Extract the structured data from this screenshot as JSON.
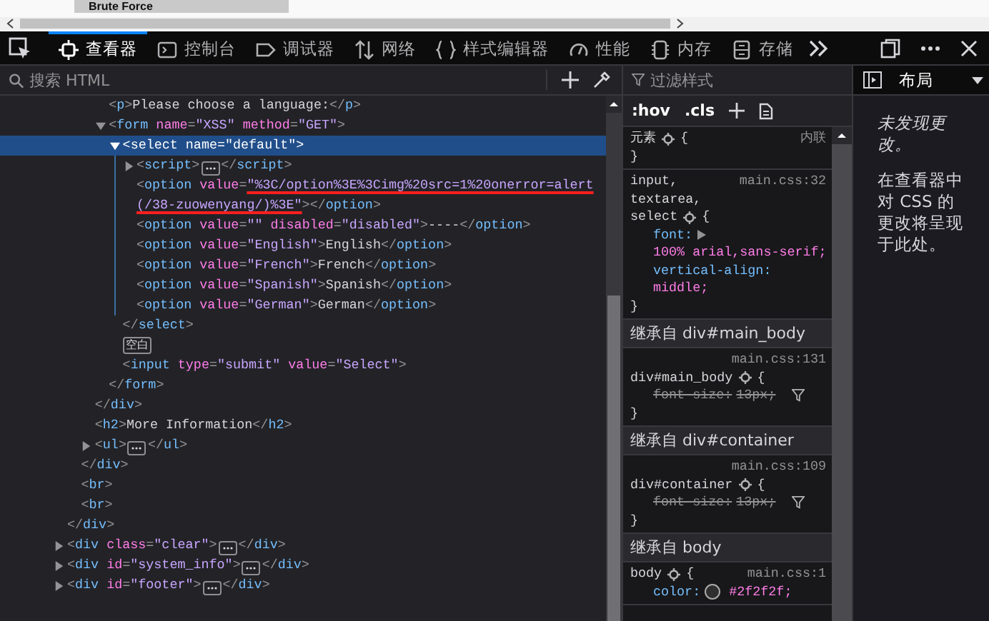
{
  "page": {
    "button_label": "Brute Force"
  },
  "toolbar": {
    "tabs": [
      {
        "kind": "inspector",
        "label": "查看器",
        "selected": true
      },
      {
        "kind": "console",
        "label": "控制台",
        "selected": false
      },
      {
        "kind": "debugger",
        "label": "调试器",
        "selected": false
      },
      {
        "kind": "network",
        "label": "网络",
        "selected": false
      },
      {
        "kind": "style-editor",
        "label": "样式编辑器",
        "selected": false
      },
      {
        "kind": "performance",
        "label": "性能",
        "selected": false
      },
      {
        "kind": "memory",
        "label": "内存",
        "selected": false
      },
      {
        "kind": "storage",
        "label": "存储",
        "selected": false
      }
    ]
  },
  "markup": {
    "search_placeholder": "搜索 HTML",
    "nodes": [
      {
        "close": [
          {
            "kind": "punct",
            "text": "</"
          },
          {
            "kind": "tag",
            "text": "div"
          },
          {
            "kind": "punct",
            "text": ">"
          }
        ],
        "children": [
          {
            "close": [
              {
                "kind": "punct",
                "text": "</"
              },
              {
                "kind": "tag",
                "text": "div"
              },
              {
                "kind": "punct",
                "text": ">"
              }
            ],
            "children": [
              {
                "close": [
                  {
                    "kind": "punct",
                    "text": "</"
                  },
                  {
                    "kind": "tag",
                    "text": "div"
                  },
                  {
                    "kind": "punct",
                    "text": ">"
                  }
                ],
                "children": [
                  {
                    "selected": false,
                    "tokens": [
                      {
                        "kind": "punct",
                        "text": "<"
                      },
                      {
                        "kind": "tag",
                        "text": "p"
                      },
                      {
                        "kind": "punct",
                        "text": ">"
                      },
                      {
                        "kind": "text",
                        "text": "Please choose a language:"
                      },
                      {
                        "kind": "punct",
                        "text": "</"
                      },
                      {
                        "kind": "tag",
                        "text": "p"
                      },
                      {
                        "kind": "punct",
                        "text": ">"
                      }
                    ]
                  },
                  {
                    "selected": false,
                    "expanded": true,
                    "tokens": [
                      {
                        "kind": "punct",
                        "text": "<"
                      },
                      {
                        "kind": "tag",
                        "text": "form"
                      },
                      {
                        "kind": "attr",
                        "text": " name"
                      },
                      {
                        "kind": "punct",
                        "text": "="
                      },
                      {
                        "kind": "value",
                        "text": "\"XSS\""
                      },
                      {
                        "kind": "attr",
                        "text": " method"
                      },
                      {
                        "kind": "punct",
                        "text": "="
                      },
                      {
                        "kind": "value",
                        "text": "\"GET\""
                      },
                      {
                        "kind": "punct",
                        "text": ">"
                      }
                    ],
                    "close": [
                      {
                        "kind": "punct",
                        "text": "</"
                      },
                      {
                        "kind": "tag",
                        "text": "form"
                      },
                      {
                        "kind": "punct",
                        "text": ">"
                      }
                    ],
                    "children": [
                      {
                        "selected": true,
                        "expanded": true,
                        "tokens": [
                          {
                            "kind": "punct",
                            "text": "<"
                          },
                          {
                            "kind": "tag",
                            "text": "select"
                          },
                          {
                            "kind": "attr",
                            "text": " name"
                          },
                          {
                            "kind": "punct",
                            "text": "="
                          },
                          {
                            "kind": "value",
                            "text": "\"default\""
                          },
                          {
                            "kind": "punct",
                            "text": ">"
                          }
                        ],
                        "close": [
                          {
                            "kind": "punct",
                            "text": "</"
                          },
                          {
                            "kind": "tag",
                            "text": "select"
                          },
                          {
                            "kind": "punct",
                            "text": ">"
                          }
                        ],
                        "children": [
                          {
                            "selected": false,
                            "expanded": false,
                            "tokens": [
                              {
                                "kind": "punct",
                                "text": "<"
                              },
                              {
                                "kind": "tag",
                                "text": "script"
                              },
                              {
                                "kind": "punct",
                                "text": ">"
                              },
                              {
                                "kind": "ellipsis"
                              },
                              {
                                "kind": "punct",
                                "text": "</"
                              },
                              {
                                "kind": "tag",
                                "text": "script"
                              },
                              {
                                "kind": "punct",
                                "text": ">"
                              }
                            ]
                          },
                          {
                            "selected": false,
                            "tokens": [
                              {
                                "kind": "punct",
                                "text": "<"
                              },
                              {
                                "kind": "tag",
                                "text": "option"
                              },
                              {
                                "kind": "attr",
                                "text": " value"
                              },
                              {
                                "kind": "punct",
                                "text": "="
                              },
                              {
                                "kind": "value",
                                "text": "\"%3C/option%3E%3Cimg%20src=1%20onerror=alert(/38-zuowenyang/)%3E\"",
                                "annotated": true
                              },
                              {
                                "kind": "punct",
                                "text": ">"
                              },
                              {
                                "kind": "punct",
                                "text": "</"
                              },
                              {
                                "kind": "tag",
                                "text": "option"
                              },
                              {
                                "kind": "punct",
                                "text": ">"
                              }
                            ]
                          },
                          {
                            "selected": false,
                            "tokens": [
                              {
                                "kind": "punct",
                                "text": "<"
                              },
                              {
                                "kind": "tag",
                                "text": "option"
                              },
                              {
                                "kind": "attr",
                                "text": " value"
                              },
                              {
                                "kind": "punct",
                                "text": "="
                              },
                              {
                                "kind": "value",
                                "text": "\"\""
                              },
                              {
                                "kind": "attr",
                                "text": " disabled"
                              },
                              {
                                "kind": "punct",
                                "text": "="
                              },
                              {
                                "kind": "value",
                                "text": "\"disabled\""
                              },
                              {
                                "kind": "punct",
                                "text": ">"
                              },
                              {
                                "kind": "text",
                                "text": "----"
                              },
                              {
                                "kind": "punct",
                                "text": "</"
                              },
                              {
                                "kind": "tag",
                                "text": "option"
                              },
                              {
                                "kind": "punct",
                                "text": ">"
                              }
                            ]
                          },
                          {
                            "selected": false,
                            "tokens": [
                              {
                                "kind": "punct",
                                "text": "<"
                              },
                              {
                                "kind": "tag",
                                "text": "option"
                              },
                              {
                                "kind": "attr",
                                "text": " value"
                              },
                              {
                                "kind": "punct",
                                "text": "="
                              },
                              {
                                "kind": "value",
                                "text": "\"English\""
                              },
                              {
                                "kind": "punct",
                                "text": ">"
                              },
                              {
                                "kind": "text",
                                "text": "English"
                              },
                              {
                                "kind": "punct",
                                "text": "</"
                              },
                              {
                                "kind": "tag",
                                "text": "option"
                              },
                              {
                                "kind": "punct",
                                "text": ">"
                              }
                            ]
                          },
                          {
                            "selected": false,
                            "tokens": [
                              {
                                "kind": "punct",
                                "text": "<"
                              },
                              {
                                "kind": "tag",
                                "text": "option"
                              },
                              {
                                "kind": "attr",
                                "text": " value"
                              },
                              {
                                "kind": "punct",
                                "text": "="
                              },
                              {
                                "kind": "value",
                                "text": "\"French\""
                              },
                              {
                                "kind": "punct",
                                "text": ">"
                              },
                              {
                                "kind": "text",
                                "text": "French"
                              },
                              {
                                "kind": "punct",
                                "text": "</"
                              },
                              {
                                "kind": "tag",
                                "text": "option"
                              },
                              {
                                "kind": "punct",
                                "text": ">"
                              }
                            ]
                          },
                          {
                            "selected": false,
                            "tokens": [
                              {
                                "kind": "punct",
                                "text": "<"
                              },
                              {
                                "kind": "tag",
                                "text": "option"
                              },
                              {
                                "kind": "attr",
                                "text": " value"
                              },
                              {
                                "kind": "punct",
                                "text": "="
                              },
                              {
                                "kind": "value",
                                "text": "\"Spanish\""
                              },
                              {
                                "kind": "punct",
                                "text": ">"
                              },
                              {
                                "kind": "text",
                                "text": "Spanish"
                              },
                              {
                                "kind": "punct",
                                "text": "</"
                              },
                              {
                                "kind": "tag",
                                "text": "option"
                              },
                              {
                                "kind": "punct",
                                "text": ">"
                              }
                            ]
                          },
                          {
                            "selected": false,
                            "tokens": [
                              {
                                "kind": "punct",
                                "text": "<"
                              },
                              {
                                "kind": "tag",
                                "text": "option"
                              },
                              {
                                "kind": "attr",
                                "text": " value"
                              },
                              {
                                "kind": "punct",
                                "text": "="
                              },
                              {
                                "kind": "value",
                                "text": "\"German\""
                              },
                              {
                                "kind": "punct",
                                "text": ">"
                              },
                              {
                                "kind": "text",
                                "text": "German"
                              },
                              {
                                "kind": "punct",
                                "text": "</"
                              },
                              {
                                "kind": "tag",
                                "text": "option"
                              },
                              {
                                "kind": "punct",
                                "text": ">"
                              }
                            ]
                          }
                        ]
                      },
                      {
                        "kind": "whitespace",
                        "label": "空白",
                        "selected": false
                      },
                      {
                        "selected": false,
                        "tokens": [
                          {
                            "kind": "punct",
                            "text": "<"
                          },
                          {
                            "kind": "tag",
                            "text": "input"
                          },
                          {
                            "kind": "attr",
                            "text": " type"
                          },
                          {
                            "kind": "punct",
                            "text": "="
                          },
                          {
                            "kind": "value",
                            "text": "\"submit\""
                          },
                          {
                            "kind": "attr",
                            "text": " value"
                          },
                          {
                            "kind": "punct",
                            "text": "="
                          },
                          {
                            "kind": "value",
                            "text": "\"Select\""
                          },
                          {
                            "kind": "punct",
                            "text": ">"
                          }
                        ]
                      }
                    ]
                  }
                ]
              },
              {
                "selected": false,
                "tokens": [
                  {
                    "kind": "punct",
                    "text": "<"
                  },
                  {
                    "kind": "tag",
                    "text": "h2"
                  },
                  {
                    "kind": "punct",
                    "text": ">"
                  },
                  {
                    "kind": "text",
                    "text": "More Information"
                  },
                  {
                    "kind": "punct",
                    "text": "</"
                  },
                  {
                    "kind": "tag",
                    "text": "h2"
                  },
                  {
                    "kind": "punct",
                    "text": ">"
                  }
                ]
              },
              {
                "selected": false,
                "expanded": false,
                "tokens": [
                  {
                    "kind": "punct",
                    "text": "<"
                  },
                  {
                    "kind": "tag",
                    "text": "ul"
                  },
                  {
                    "kind": "punct",
                    "text": ">"
                  },
                  {
                    "kind": "ellipsis"
                  },
                  {
                    "kind": "punct",
                    "text": "</"
                  },
                  {
                    "kind": "tag",
                    "text": "ul"
                  },
                  {
                    "kind": "punct",
                    "text": ">"
                  }
                ]
              }
            ]
          },
          {
            "selected": false,
            "tokens": [
              {
                "kind": "punct",
                "text": "<"
              },
              {
                "kind": "tag",
                "text": "br"
              },
              {
                "kind": "punct",
                "text": ">"
              }
            ]
          },
          {
            "selected": false,
            "tokens": [
              {
                "kind": "punct",
                "text": "<"
              },
              {
                "kind": "tag",
                "text": "br"
              },
              {
                "kind": "punct",
                "text": ">"
              }
            ]
          }
        ]
      },
      {
        "selected": false,
        "expanded": false,
        "tokens": [
          {
            "kind": "punct",
            "text": "<"
          },
          {
            "kind": "tag",
            "text": "div"
          },
          {
            "kind": "attr",
            "text": " class"
          },
          {
            "kind": "punct",
            "text": "="
          },
          {
            "kind": "value",
            "text": "\"clear\""
          },
          {
            "kind": "punct",
            "text": ">"
          },
          {
            "kind": "ellipsis"
          },
          {
            "kind": "punct",
            "text": "</"
          },
          {
            "kind": "tag",
            "text": "div"
          },
          {
            "kind": "punct",
            "text": ">"
          }
        ]
      },
      {
        "selected": false,
        "expanded": false,
        "tokens": [
          {
            "kind": "punct",
            "text": "<"
          },
          {
            "kind": "tag",
            "text": "div"
          },
          {
            "kind": "attr",
            "text": " id"
          },
          {
            "kind": "punct",
            "text": "="
          },
          {
            "kind": "value",
            "text": "\"system_info\""
          },
          {
            "kind": "punct",
            "text": ">"
          },
          {
            "kind": "ellipsis"
          },
          {
            "kind": "punct",
            "text": "</"
          },
          {
            "kind": "tag",
            "text": "div"
          },
          {
            "kind": "punct",
            "text": ">"
          }
        ]
      },
      {
        "selected": false,
        "expanded": false,
        "tokens": [
          {
            "kind": "punct",
            "text": "<"
          },
          {
            "kind": "tag",
            "text": "div"
          },
          {
            "kind": "attr",
            "text": " id"
          },
          {
            "kind": "punct",
            "text": "="
          },
          {
            "kind": "value",
            "text": "\"footer\""
          },
          {
            "kind": "punct",
            "text": ">"
          },
          {
            "kind": "ellipsis"
          },
          {
            "kind": "punct",
            "text": "</"
          },
          {
            "kind": "tag",
            "text": "div"
          },
          {
            "kind": "punct",
            "text": ">"
          }
        ]
      }
    ]
  },
  "rules": {
    "filter_placeholder": "过滤样式",
    "pseudo_toggle": ":hov",
    "class_toggle": ".cls",
    "sections": [
      {
        "kind": "rule",
        "selectors": [
          "元素"
        ],
        "source": "内联",
        "brace_open": "{",
        "brace_close": "}"
      },
      {
        "kind": "rule",
        "selectors": [
          "input,",
          "textarea,",
          "select"
        ],
        "source": "main.css:32",
        "brace_open": "{",
        "brace_close": "}",
        "declarations": [
          {
            "property": "font:",
            "value": "100% arial,sans-serif;",
            "expandable": true,
            "overridden": false
          },
          {
            "property": "vertical-align:",
            "value": "middle;",
            "overridden": false
          }
        ]
      },
      {
        "kind": "header",
        "text": "继承自 div#main_body"
      },
      {
        "kind": "rule",
        "selectors": [
          "div#main_body"
        ],
        "source": "main.css:131",
        "brace_open": "{",
        "brace_close": "}",
        "declarations": [
          {
            "property": "font-size:",
            "value": "13px;",
            "overridden": true
          }
        ]
      },
      {
        "kind": "header",
        "text": "继承自 div#container"
      },
      {
        "kind": "rule",
        "selectors": [
          "div#container"
        ],
        "source": "main.css:109",
        "brace_open": "{",
        "brace_close": "}",
        "declarations": [
          {
            "property": "font-size:",
            "value": "13px;",
            "overridden": true
          }
        ]
      },
      {
        "kind": "header",
        "text": "继承自 body"
      },
      {
        "kind": "rule",
        "selectors": [
          "body"
        ],
        "source": "main.css:1",
        "brace_open": "{",
        "declarations": [
          {
            "property": "color:",
            "value": "#2f2f2f;",
            "color": "#2f2f2f",
            "overridden": false
          }
        ]
      }
    ]
  },
  "changes": {
    "tab": "布局",
    "title": "未发现更改。",
    "hint": "在查看器中对 CSS 的更改将呈现于此处。"
  }
}
